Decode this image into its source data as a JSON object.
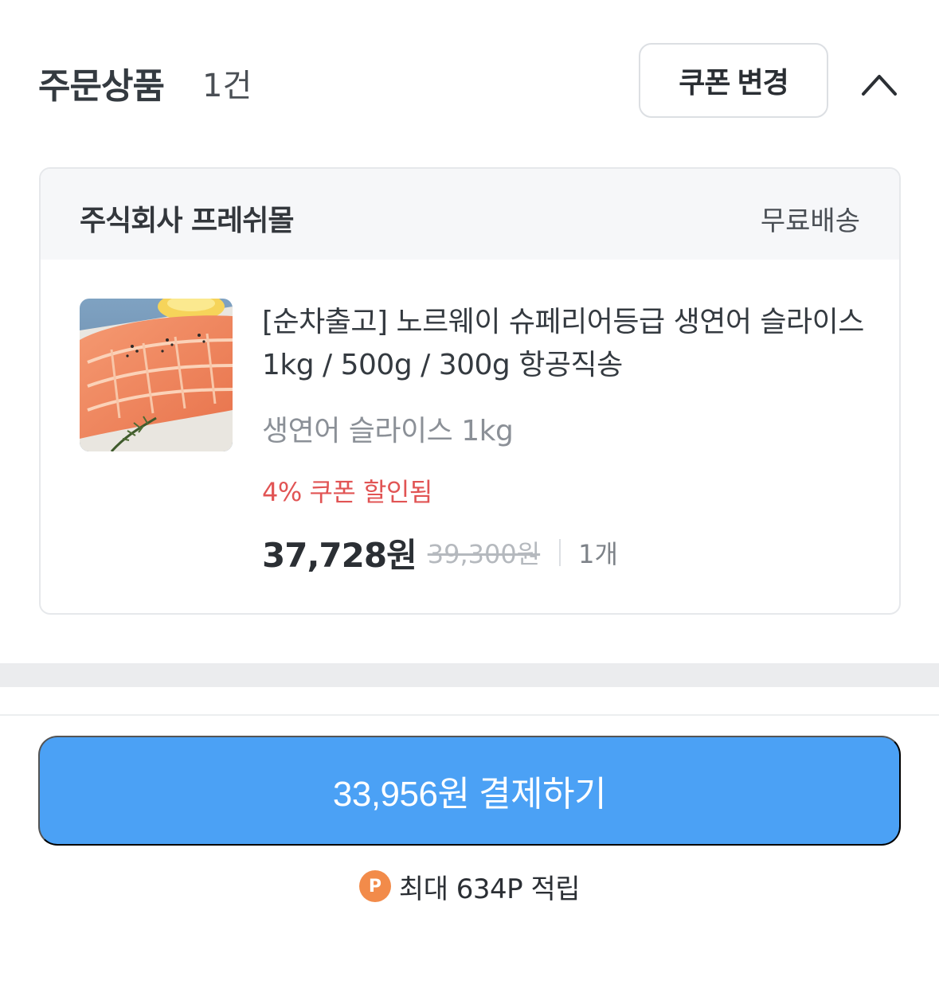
{
  "header": {
    "title": "주문상품",
    "count": "1건",
    "coupon_button": "쿠폰 변경",
    "collapse_icon": "chevron-up-icon"
  },
  "seller": {
    "name": "주식회사 프레쉬몰",
    "shipping": "무료배송"
  },
  "product": {
    "name": "[순차출고] 노르웨이 슈페리어등급 생연어 슬라이스 1kg / 500g / 300g 항공직송",
    "option": "생연어 슬라이스 1kg",
    "discount": "4% 쿠폰 할인됨",
    "price": "37,728원",
    "original_price": "39,300원",
    "quantity": "1개"
  },
  "checkout": {
    "pay_button": "33,956원 결제하기",
    "points_icon": "P",
    "points_text": "최대 634P 적립"
  },
  "colors": {
    "accent": "#4ba1f5",
    "discount": "#e15454",
    "points": "#f28b4a"
  }
}
